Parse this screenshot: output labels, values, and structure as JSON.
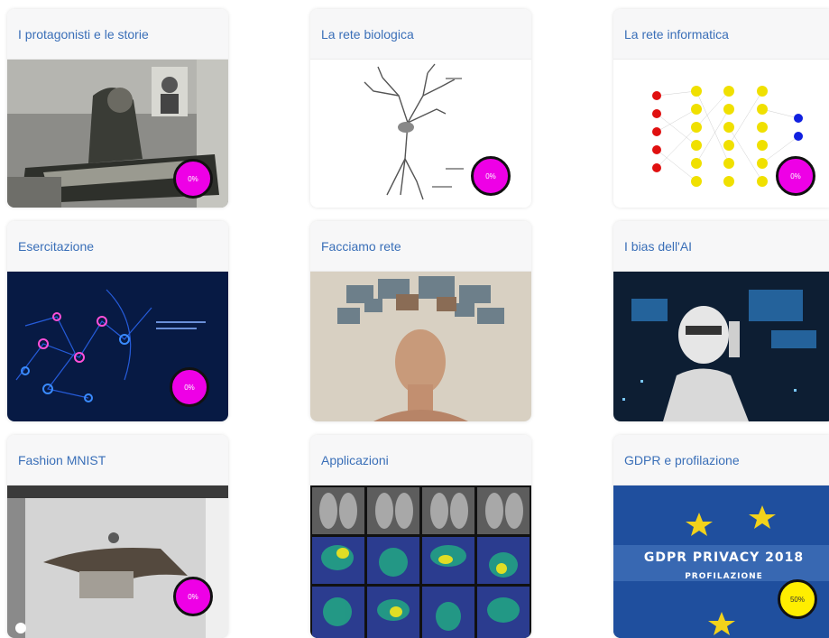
{
  "cards": [
    {
      "title": "I protagonisti e le storie",
      "progress": "0%",
      "image": "historical-photo-man-reading",
      "badge_color": "#ee00e6"
    },
    {
      "title": "La rete biologica",
      "progress": "0%",
      "image": "neuron-diagram",
      "badge_color": "#ee00e6"
    },
    {
      "title": "La rete informatica",
      "progress": "0%",
      "image": "neural-network-diagram",
      "badge_color": "#ee00e6"
    },
    {
      "title": "Esercitazione",
      "progress": "0%",
      "image": "neon-network-graphic",
      "badge_color": "#ee00e6"
    },
    {
      "title": "Facciamo rete",
      "progress": "",
      "image": "woman-face-photo-collage",
      "badge_color": ""
    },
    {
      "title": "I bias dell'AI",
      "progress": "",
      "image": "robot-with-scales",
      "badge_color": ""
    },
    {
      "title": "Fashion MNIST",
      "progress": "0%",
      "image": "fashion-3d-render",
      "badge_color": "#ee00e6"
    },
    {
      "title": "Applicazioni",
      "progress": "",
      "image": "chest-xray-heatmaps",
      "badge_color": ""
    },
    {
      "title": "GDPR e profilazione",
      "progress": "50%",
      "image": "gdpr-privacy-banner",
      "badge_color": "#ffee00"
    }
  ],
  "gdpr_banner": {
    "line1": "GDPR PRIVACY 2018",
    "line2": "PROFILAZIONE"
  }
}
